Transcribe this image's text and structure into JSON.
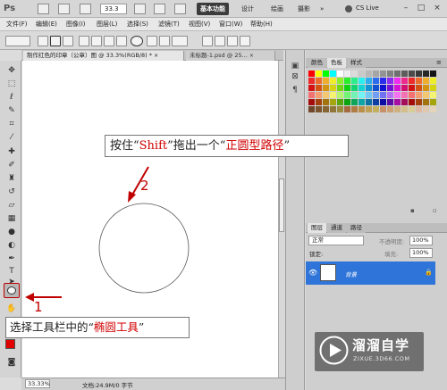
{
  "titlebar": {
    "logo": "Ps",
    "zoom": "33.3",
    "workspaces": [
      "基本功能",
      "设计",
      "绘画",
      "摄影",
      "»"
    ],
    "cs_live": "CS Live",
    "window_buttons": [
      "–",
      "□",
      "×"
    ]
  },
  "menu": [
    "文件(F)",
    "编辑(E)",
    "图像(I)",
    "图层(L)",
    "选择(S)",
    "滤镜(T)",
    "视图(V)",
    "窗口(W)",
    "帮助(H)"
  ],
  "document": {
    "tab1": "制作红色的印章（公章）图 @ 33.3%(RGB/8) *",
    "tab1_close": "×",
    "tab2": "未标题-1.psd @ 25...",
    "tab2_close": "×"
  },
  "status": {
    "zoom": "33.33%",
    "doc_info": "文档:24.9M/0 字节"
  },
  "panels": {
    "swatch_tabs": [
      "颜色",
      "色板",
      "样式"
    ],
    "layers_tabs": [
      "图层",
      "通道",
      "路径"
    ],
    "blend_mode": "正常",
    "opacity_label": "不透明度:",
    "opacity_value": "100%",
    "lock_label": "锁定:",
    "fill_label": "填充:",
    "fill_value": "100%",
    "layer_name": "背景"
  },
  "annotations": {
    "top_prefix": "按住“",
    "top_key": "Shift",
    "top_mid": "”拖出一个“",
    "top_target": "正圆型路径",
    "top_suffix": "”",
    "bottom_prefix": "选择工具栏中的“",
    "bottom_target": "椭圆工具",
    "bottom_suffix": "”",
    "step1": "1",
    "step2": "2"
  },
  "watermark": {
    "title": "溜溜自学",
    "url": "ZIXUE.3D66.COM"
  },
  "colors": {
    "foreground": "#e00000",
    "background": "#ffffff",
    "annotation_red": "#d00000",
    "layer_selected": "#2f74d8"
  }
}
